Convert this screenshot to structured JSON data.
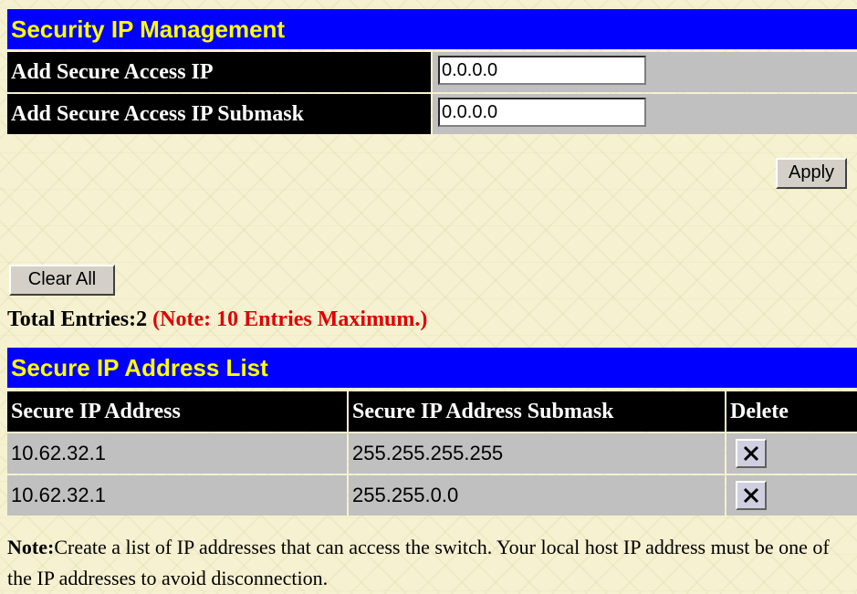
{
  "header": {
    "title": "Security IP Management"
  },
  "form": {
    "ip_label": "Add Secure Access IP",
    "ip_value": "0.0.0.0",
    "mask_label": "Add Secure Access IP Submask",
    "mask_value": "0.0.0.0"
  },
  "buttons": {
    "apply": "Apply",
    "clear_all": "Clear All"
  },
  "summary": {
    "total": "Total Entries:2",
    "note": "(Note: 10 Entries Maximum.)"
  },
  "list": {
    "title": "Secure IP Address List",
    "columns": [
      "Secure IP Address",
      "Secure IP Address Submask",
      "Delete"
    ],
    "rows": [
      {
        "ip": "10.62.32.1",
        "mask": "255.255.255.255"
      },
      {
        "ip": "10.62.32.1",
        "mask": "255.255.0.0"
      }
    ]
  },
  "footnote": {
    "label": "Note:",
    "text": "Create a list of IP addresses that can access the switch. Your local host IP address must be one of the IP addresses to avoid disconnection."
  },
  "icons": {
    "delete": "delete-x-icon"
  },
  "colors": {
    "header_bg": "#0000ff",
    "header_text": "#ffff00",
    "label_bg": "#000000",
    "note_red": "#e00000"
  }
}
